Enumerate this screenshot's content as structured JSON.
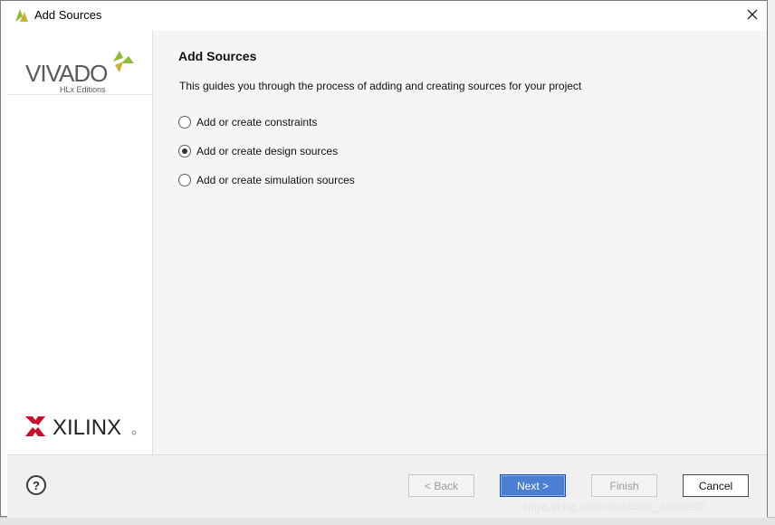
{
  "window": {
    "title": "Add Sources"
  },
  "branding": {
    "vivado_text": "VIVADO",
    "vivado_sub": "HLx Editions",
    "xilinx_text": "XILINX",
    "vivado_color": "#555555",
    "accent": "#8cba3a",
    "xilinx_red": "#c8102e"
  },
  "main": {
    "heading": "Add Sources",
    "description": "This guides you through the process of adding and creating sources for your project",
    "options": [
      {
        "label": "Add or create constraints",
        "selected": false
      },
      {
        "label": "Add or create design sources",
        "selected": true
      },
      {
        "label": "Add or create simulation sources",
        "selected": false
      }
    ]
  },
  "footer": {
    "help": "?",
    "back": "< Back",
    "next": "Next >",
    "finish": "Finish",
    "cancel": "Cancel"
  },
  "watermark": "https://blog.csdn.net/weixin_44304451"
}
